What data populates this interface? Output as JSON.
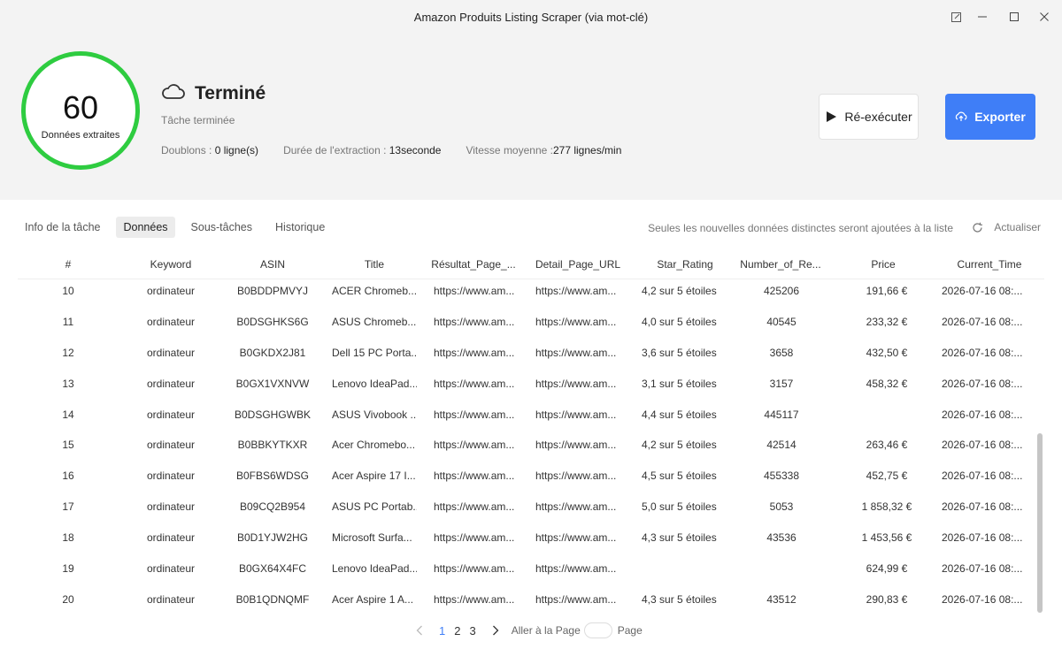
{
  "window": {
    "title": "Amazon Produits Listing Scraper (via mot-clé)"
  },
  "summary": {
    "count": "60",
    "count_label": "Données extraites",
    "status": "Terminé",
    "subtitle": "Tâche terminée",
    "doublons_label": "Doublons : ",
    "doublons_value": "0 ligne(s)",
    "duree_label": "Durée de l'extraction : ",
    "duree_value": "13seconde",
    "vitesse_label": "Vitesse moyenne :",
    "vitesse_value": "277 lignes/min",
    "status_color": "#2ecc40"
  },
  "actions": {
    "rerun_label": "Ré-exécuter",
    "export_label": "Exporter",
    "export_color": "#3f7ef7"
  },
  "tabs": [
    {
      "label": "Info de la tâche"
    },
    {
      "label": "Données",
      "active": true
    },
    {
      "label": "Sous-tâches"
    },
    {
      "label": "Historique"
    }
  ],
  "notice": "Seules les nouvelles données distinctes seront ajoutées à la liste",
  "refresh_label": "Actualiser",
  "table": {
    "headers": [
      "#",
      "Keyword",
      "ASIN",
      "Title",
      "Résultat_Page_...",
      "Detail_Page_URL",
      "Star_Rating",
      "Number_of_Re...",
      "Price",
      "Current_Time"
    ],
    "rows": [
      [
        "10",
        "ordinateur",
        "B0BDDPMVYJ",
        "ACER Chromeb...",
        "https://www.am...",
        "https://www.am...",
        "4,2 sur 5 étoiles",
        "425206",
        "191,66 €",
        "2026-07-16 08:..."
      ],
      [
        "11",
        "ordinateur",
        "B0DSGHKS6G",
        "ASUS Chromeb...",
        "https://www.am...",
        "https://www.am...",
        "4,0 sur 5 étoiles",
        "40545",
        "233,32 €",
        "2026-07-16 08:..."
      ],
      [
        "12",
        "ordinateur",
        "B0GKDX2J81",
        "Dell 15 PC Porta...",
        "https://www.am...",
        "https://www.am...",
        "3,6 sur 5 étoiles",
        "3658",
        "432,50 €",
        "2026-07-16 08:..."
      ],
      [
        "13",
        "ordinateur",
        "B0GX1VXNVW",
        "Lenovo IdeaPad...",
        "https://www.am...",
        "https://www.am...",
        "3,1 sur 5 étoiles",
        "3157",
        "458,32 €",
        "2026-07-16 08:..."
      ],
      [
        "14",
        "ordinateur",
        "B0DSGHGWBK",
        "ASUS Vivobook ...",
        "https://www.am...",
        "https://www.am...",
        "4,4 sur 5 étoiles",
        "445117",
        "",
        "2026-07-16 08:..."
      ],
      [
        "15",
        "ordinateur",
        "B0BBKYTKXR",
        "Acer Chromebo...",
        "https://www.am...",
        "https://www.am...",
        "4,2 sur 5 étoiles",
        "42514",
        "263,46 €",
        "2026-07-16 08:..."
      ],
      [
        "16",
        "ordinateur",
        "B0FBS6WDSG",
        "Acer Aspire 17 I...",
        "https://www.am...",
        "https://www.am...",
        "4,5 sur 5 étoiles",
        "455338",
        "452,75 €",
        "2026-07-16 08:..."
      ],
      [
        "17",
        "ordinateur",
        "B09CQ2B954",
        "ASUS PC Portab...",
        "https://www.am...",
        "https://www.am...",
        "5,0 sur 5 étoiles",
        "5053",
        "1 858,32 €",
        "2026-07-16 08:..."
      ],
      [
        "18",
        "ordinateur",
        "B0D1YJW2HG",
        "Microsoft Surfa...",
        "https://www.am...",
        "https://www.am...",
        "4,3 sur 5 étoiles",
        "43536",
        "1 453,56 €",
        "2026-07-16 08:..."
      ],
      [
        "19",
        "ordinateur",
        "B0GX64X4FC",
        "Lenovo IdeaPad...",
        "https://www.am...",
        "https://www.am...",
        "",
        "",
        "624,99 €",
        "2026-07-16 08:..."
      ],
      [
        "20",
        "ordinateur",
        "B0B1QDNQMF",
        "Acer Aspire 1 A...",
        "https://www.am...",
        "https://www.am...",
        "4,3 sur 5 étoiles",
        "43512",
        "290,83 €",
        "2026-07-16 08:..."
      ]
    ]
  },
  "pagination": {
    "pages": [
      "1",
      "2",
      "3"
    ],
    "current": "1",
    "goto_label": "Aller à la Page",
    "page_label": "Page"
  }
}
